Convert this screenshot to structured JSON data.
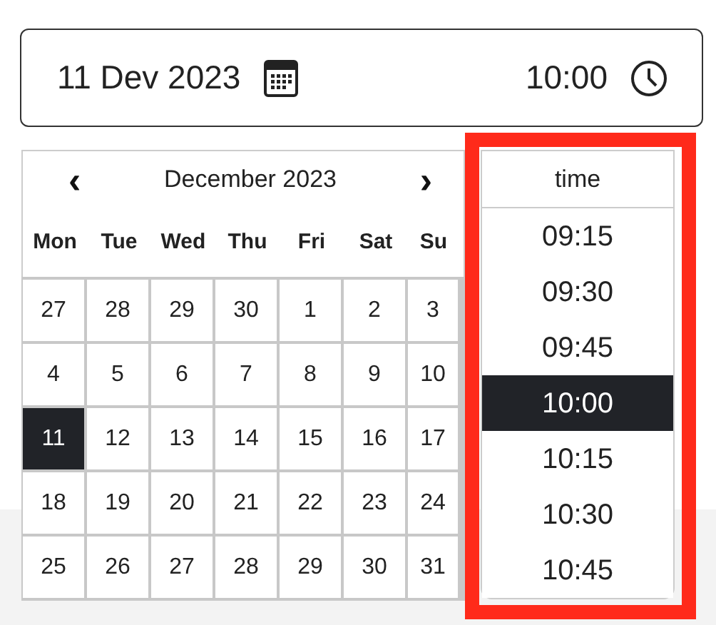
{
  "field": {
    "date": "11 Dev 2023",
    "time": "10:00"
  },
  "calendar": {
    "month": "December 2023",
    "prev": "‹",
    "next": "›",
    "weekdays": [
      "Mon",
      "Tue",
      "Wed",
      "Thu",
      "Fri",
      "Sat",
      "Su"
    ],
    "weeks": [
      [
        {
          "day": "27",
          "selected": false
        },
        {
          "day": "28",
          "selected": false
        },
        {
          "day": "29",
          "selected": false
        },
        {
          "day": "30",
          "selected": false
        },
        {
          "day": "1",
          "selected": false
        },
        {
          "day": "2",
          "selected": false
        },
        {
          "day": "3",
          "selected": false
        }
      ],
      [
        {
          "day": "4",
          "selected": false
        },
        {
          "day": "5",
          "selected": false
        },
        {
          "day": "6",
          "selected": false
        },
        {
          "day": "7",
          "selected": false
        },
        {
          "day": "8",
          "selected": false
        },
        {
          "day": "9",
          "selected": false
        },
        {
          "day": "10",
          "selected": false
        }
      ],
      [
        {
          "day": "11",
          "selected": true
        },
        {
          "day": "12",
          "selected": false
        },
        {
          "day": "13",
          "selected": false
        },
        {
          "day": "14",
          "selected": false
        },
        {
          "day": "15",
          "selected": false
        },
        {
          "day": "16",
          "selected": false
        },
        {
          "day": "17",
          "selected": false
        }
      ],
      [
        {
          "day": "18",
          "selected": false
        },
        {
          "day": "19",
          "selected": false
        },
        {
          "day": "20",
          "selected": false
        },
        {
          "day": "21",
          "selected": false
        },
        {
          "day": "22",
          "selected": false
        },
        {
          "day": "23",
          "selected": false
        },
        {
          "day": "24",
          "selected": false
        }
      ],
      [
        {
          "day": "25",
          "selected": false
        },
        {
          "day": "26",
          "selected": false
        },
        {
          "day": "27",
          "selected": false
        },
        {
          "day": "28",
          "selected": false
        },
        {
          "day": "29",
          "selected": false
        },
        {
          "day": "30",
          "selected": false
        },
        {
          "day": "31",
          "selected": false
        }
      ]
    ]
  },
  "time_list": {
    "header": "time",
    "times": [
      {
        "label": "09:15",
        "selected": false
      },
      {
        "label": "09:30",
        "selected": false
      },
      {
        "label": "09:45",
        "selected": false
      },
      {
        "label": "10:00",
        "selected": true
      },
      {
        "label": "10:15",
        "selected": false
      },
      {
        "label": "10:30",
        "selected": false
      },
      {
        "label": "10:45",
        "selected": false
      }
    ]
  }
}
